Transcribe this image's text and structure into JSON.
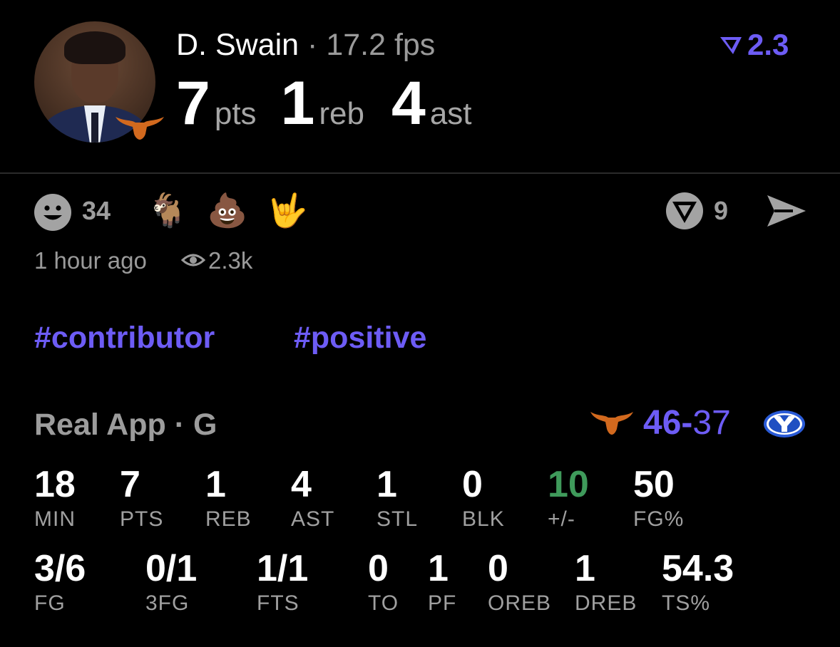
{
  "player": {
    "name": "D. Swain",
    "separator": "·",
    "fps": "17.2 fps",
    "big_stats": [
      {
        "value": "7",
        "label": "pts"
      },
      {
        "value": "1",
        "label": "reb"
      },
      {
        "value": "4",
        "label": "ast"
      }
    ],
    "rating": "2.3"
  },
  "reactions": {
    "count": "34",
    "emojis": [
      "🐐",
      "💩",
      "🤟"
    ],
    "comments": "9",
    "time": "1 hour ago",
    "views": "2.3k"
  },
  "tags": [
    "#contributor",
    "#positive"
  ],
  "game": {
    "league": "Real App",
    "separator": "·",
    "position": "G",
    "home_score": "46",
    "dash": "-",
    "away_score": "37"
  },
  "stats_row1": [
    {
      "value": "18",
      "label": "MIN"
    },
    {
      "value": "7",
      "label": "PTS"
    },
    {
      "value": "1",
      "label": "REB"
    },
    {
      "value": "4",
      "label": "AST"
    },
    {
      "value": "1",
      "label": "STL"
    },
    {
      "value": "0",
      "label": "BLK"
    },
    {
      "value": "10",
      "label": "+/-"
    },
    {
      "value": "50",
      "label": "FG%"
    }
  ],
  "stats_row2": [
    {
      "value": "3/6",
      "label": "FG"
    },
    {
      "value": "0/1",
      "label": "3FG"
    },
    {
      "value": "1/1",
      "label": "FTS"
    },
    {
      "value": "0",
      "label": "TO"
    },
    {
      "value": "1",
      "label": "PF"
    },
    {
      "value": "0",
      "label": "OREB"
    },
    {
      "value": "1",
      "label": "DREB"
    },
    {
      "value": "54.3",
      "label": "TS%"
    }
  ],
  "colors": {
    "accent": "#6d5cf5",
    "positive": "#3f9a5b",
    "longhorn": "#d2691e",
    "muted": "#9a9a9a",
    "background": "#000000"
  },
  "icons": [
    "smiley-icon",
    "comment-icon",
    "send-icon",
    "eye-icon",
    "rating-icon",
    "longhorn-logo",
    "byu-logo"
  ]
}
